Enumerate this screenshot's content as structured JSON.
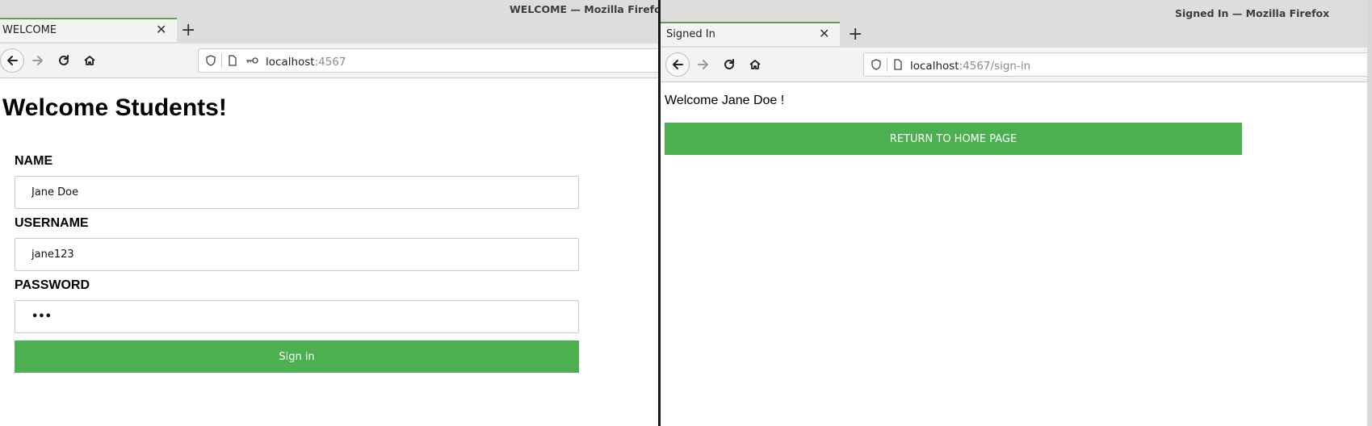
{
  "left_window": {
    "window_title": "WELCOME — Mozilla Firefox",
    "tab_title": "WELCOME",
    "url_host": "localhost",
    "url_rest": ":4567",
    "page": {
      "heading": "Welcome Students!",
      "fields": [
        {
          "label": "NAME",
          "value": "Jane Doe"
        },
        {
          "label": "USERNAME",
          "value": "jane123"
        },
        {
          "label": "PASSWORD",
          "value": "•••"
        }
      ],
      "submit_label": "Sign in"
    }
  },
  "right_window": {
    "window_title": "Signed In — Mozilla Firefox",
    "tab_title": "Signed In",
    "url_host": "localhost",
    "url_rest": ":4567/sign-in",
    "page": {
      "welcome_message": "Welcome Jane Doe !",
      "return_label": "RETURN TO HOME PAGE"
    }
  },
  "icons": {
    "close": "close-icon",
    "new_tab": "plus-icon",
    "back": "back-arrow-icon",
    "forward": "forward-arrow-icon",
    "reload": "reload-icon",
    "home": "home-icon",
    "shield": "shield-icon",
    "page": "page-icon",
    "key": "key-icon"
  },
  "colors": {
    "accent_green": "#4caf50",
    "tab_indicator": "#6a9a4a"
  }
}
